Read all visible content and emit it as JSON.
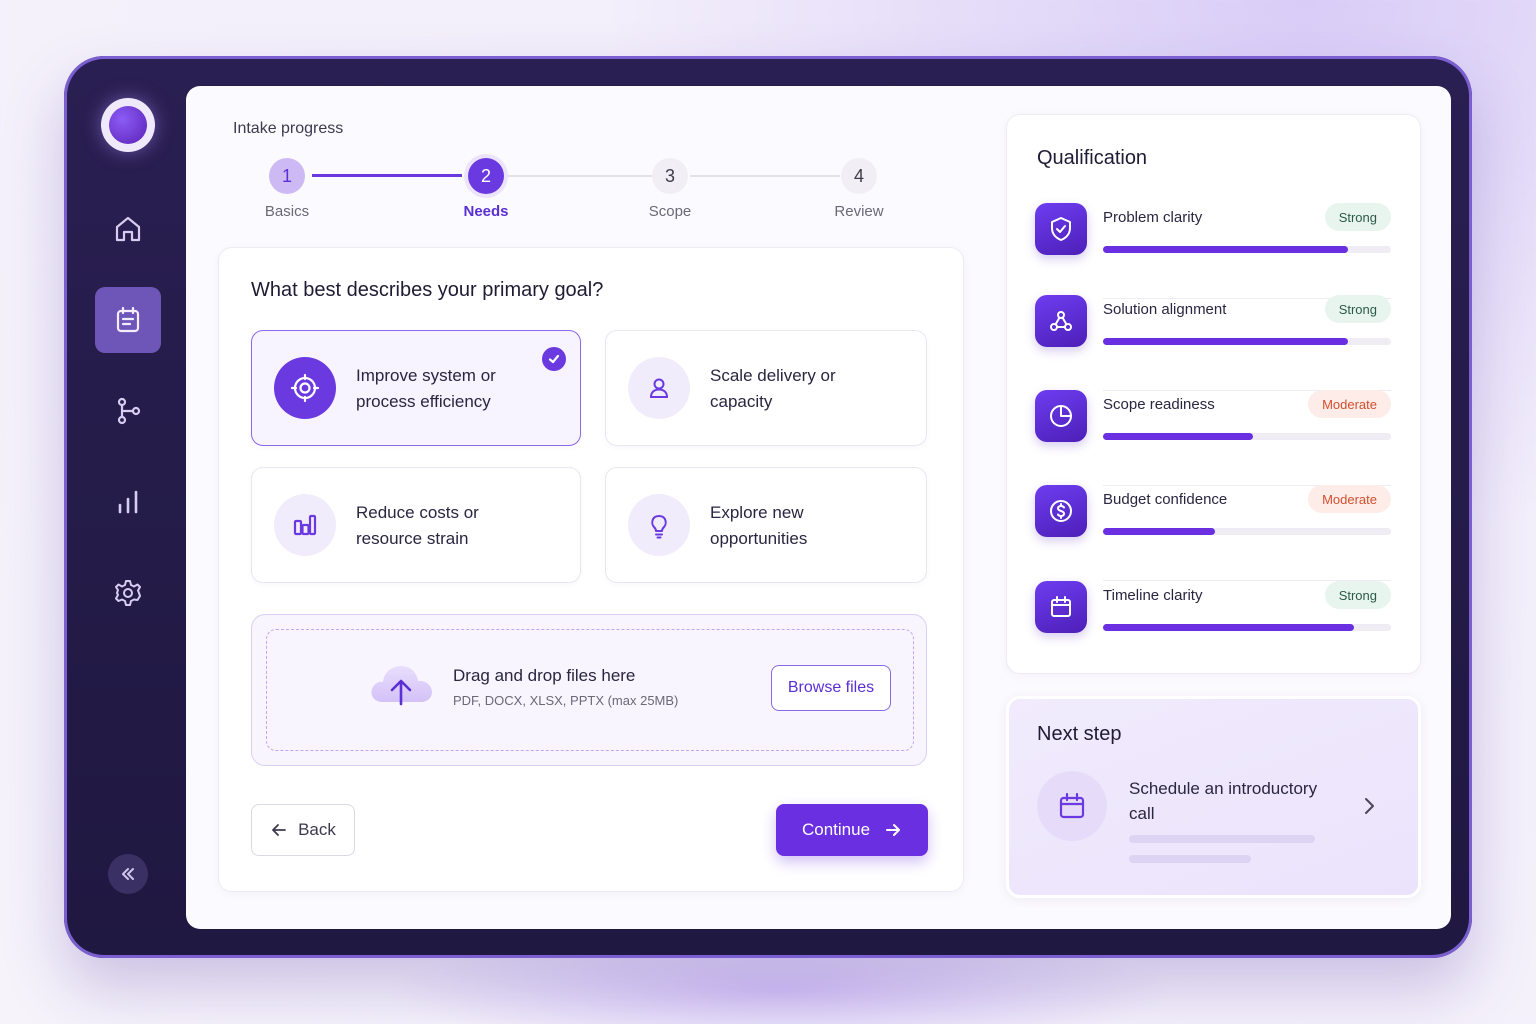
{
  "progress": {
    "title": "Intake progress",
    "steps": [
      {
        "number": "1",
        "label": "Basics",
        "state": "done"
      },
      {
        "number": "2",
        "label": "Needs",
        "state": "active"
      },
      {
        "number": "3",
        "label": "Scope",
        "state": "todo"
      },
      {
        "number": "4",
        "label": "Review",
        "state": "todo"
      }
    ]
  },
  "question": {
    "title": "What best describes your primary goal?",
    "options": [
      {
        "label": "Improve system or process efficiency",
        "icon": "target-icon",
        "selected": true
      },
      {
        "label": "Scale delivery or capacity",
        "icon": "user-icon",
        "selected": false
      },
      {
        "label": "Reduce costs or resource strain",
        "icon": "bar-chart-icon",
        "selected": false
      },
      {
        "label": "Explore new opportunities",
        "icon": "lightbulb-icon",
        "selected": false
      }
    ]
  },
  "upload": {
    "title": "Drag and drop files here",
    "subtitle": "PDF, DOCX, XLSX, PPTX (max 25MB)",
    "browse_label": "Browse files"
  },
  "actions": {
    "back_label": "Back",
    "continue_label": "Continue"
  },
  "qualification": {
    "title": "Qualification",
    "items": [
      {
        "label": "Problem clarity",
        "status": "Strong",
        "level": 0.85,
        "icon": "shield-check-icon"
      },
      {
        "label": "Solution alignment",
        "status": "Strong",
        "level": 0.85,
        "icon": "network-icon"
      },
      {
        "label": "Scope readiness",
        "status": "Moderate",
        "level": 0.52,
        "icon": "pie-chart-icon"
      },
      {
        "label": "Budget confidence",
        "status": "Moderate",
        "level": 0.39,
        "icon": "dollar-icon"
      },
      {
        "label": "Timeline clarity",
        "status": "Strong",
        "level": 0.87,
        "icon": "calendar-icon"
      }
    ]
  },
  "next_step": {
    "title": "Next step",
    "action": "Schedule an introductory call",
    "icon": "calendar-icon"
  },
  "sidebar": {
    "items": [
      "home-icon",
      "intake-icon",
      "workflow-icon",
      "analytics-icon",
      "settings-icon"
    ],
    "active": "intake-icon"
  },
  "colors": {
    "accent": "#6a2fe0",
    "frame": "#2a1f52",
    "strong_bg": "#e8f5ef",
    "moderate_text": "#d2502e"
  }
}
